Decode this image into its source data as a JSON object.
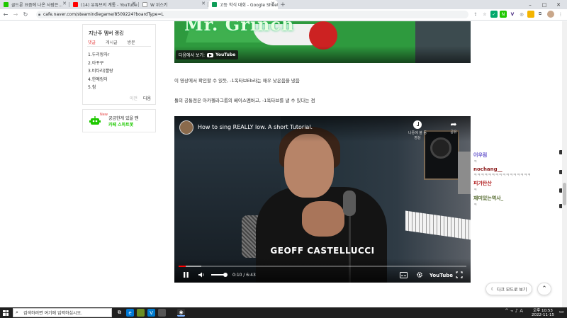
{
  "browser": {
    "tabs": [
      {
        "label": "골드룬 요즘에 나온 사람은...",
        "color": "#1ec800"
      },
      {
        "label": "(14) 유튜브의 계통 - YouTube",
        "color": "#ff0000"
      },
      {
        "label": "W 위스키",
        "color": "#fff"
      },
      {
        "label": "고등 학식 대회 - Google Sheets",
        "color": "#0f9d58"
      }
    ],
    "new_tab": "+",
    "url": "cafe.naver.com/steamindiegame/8509224?boardType=L",
    "window_controls": [
      "–",
      "□",
      "✕"
    ]
  },
  "sidebar": {
    "rank_title": "지난주 멤버 랭킹",
    "rank_tabs": [
      "댓글",
      "게시글",
      "방문"
    ],
    "rank_items": [
      "1.두리왕자r",
      "2.아꾸꾸",
      "3.비타리(빨랑",
      "4.한예링이",
      "5.첨"
    ],
    "pager_prev": "이전",
    "pager_next": "다음",
    "smartbot_new": "New",
    "smartbot_line1": "궁금한게 있을 땐",
    "smartbot_line2": "카페 스마트봇"
  },
  "article": {
    "top_video_art_text": "Mr. Grinch",
    "watch_on": "다음에서 보기:",
    "youtube_label": "YouTube",
    "para1": "이 영상에서 확인할 수 있듯, -1옥타브Eb라는 매우 낮은음을 냈음",
    "para2": "둘의 공통점은 아카펠라그룹의 베이스멤버고, -1옥타브를 낼 수 있다는 점"
  },
  "video": {
    "title": "How to sing REALLY low. A short Tutorial.",
    "watch_later": "나중에 볼 동영상",
    "share": "공유",
    "caption": "GEOFF CASTELLUCCI",
    "time": "0:10 / 6:43",
    "progress": 0.025,
    "buffered": 0.08,
    "youtube_logo": "YouTube"
  },
  "chat": [
    {
      "name": "어우림",
      "msg": "ㅋ",
      "color": "#6a5acd"
    },
    {
      "name": "nochang__",
      "msg": "ㅋㅋㅋㅋㅋㅋㅋㅋㅋㅋㅋㅋㅋㅋㅋㅋ",
      "color": "#8b1a1a"
    },
    {
      "name": "피가탄산",
      "msg": "ㅋ",
      "color": "#b22222"
    },
    {
      "name": "재미있는역사_",
      "msg": "ㅋ",
      "color": "#556b2f"
    }
  ],
  "page_buttons": {
    "dark_mode": "다크 모드로 보기",
    "to_top": "⌃"
  },
  "taskbar": {
    "search_placeholder": "검색하려면 여기에 입력하십시오.",
    "time": "오후 10:53",
    "date": "2022-11-15"
  }
}
